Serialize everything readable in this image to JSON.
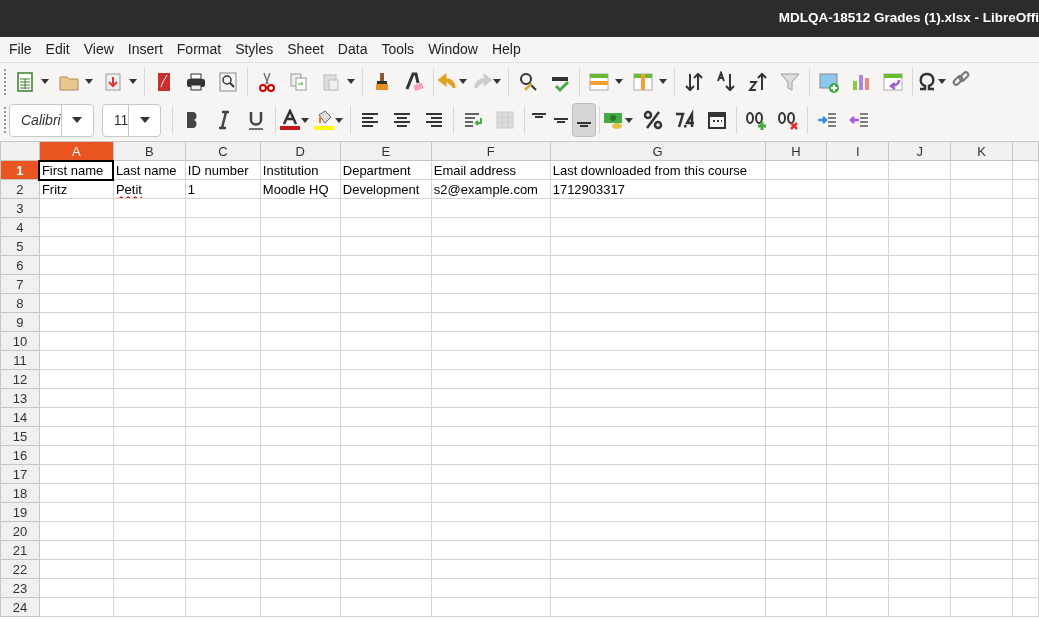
{
  "window": {
    "title": "MDLQA-18512 Grades (1).xlsx - LibreOffi"
  },
  "menu": [
    "File",
    "Edit",
    "View",
    "Insert",
    "Format",
    "Styles",
    "Sheet",
    "Data",
    "Tools",
    "Window",
    "Help"
  ],
  "font_name": {
    "value": "Calibri"
  },
  "font_size": {
    "value": "11"
  },
  "vertical_align": [
    {
      "selected": false
    },
    {
      "selected": false
    },
    {
      "selected": true
    }
  ],
  "sheet": {
    "columns": [
      {
        "label": "A",
        "selected": true
      },
      {
        "label": "B",
        "selected": false
      },
      {
        "label": "C",
        "selected": false
      },
      {
        "label": "D",
        "selected": false
      },
      {
        "label": "E",
        "selected": false
      },
      {
        "label": "F",
        "selected": false
      },
      {
        "label": "G",
        "selected": false
      },
      {
        "label": "H",
        "selected": false
      },
      {
        "label": "I",
        "selected": false
      },
      {
        "label": "J",
        "selected": false
      },
      {
        "label": "K",
        "selected": false
      }
    ],
    "rows": [
      {
        "label": "1",
        "selected": true,
        "cells": [
          {
            "text": "First name",
            "selected": true,
            "misspelled": false
          },
          {
            "text": "Last name",
            "selected": false,
            "misspelled": false
          },
          {
            "text": "ID number",
            "selected": false,
            "misspelled": false
          },
          {
            "text": "Institution",
            "selected": false,
            "misspelled": false
          },
          {
            "text": "Department",
            "selected": false,
            "misspelled": false
          },
          {
            "text": "Email address",
            "selected": false,
            "misspelled": false
          },
          {
            "text": "Last downloaded from this course",
            "selected": false,
            "misspelled": false
          }
        ]
      },
      {
        "label": "2",
        "selected": false,
        "cells": [
          {
            "text": "Fritz",
            "selected": false,
            "misspelled": false
          },
          {
            "text": "Petit",
            "selected": false,
            "misspelled": true
          },
          {
            "text": "1",
            "selected": false,
            "misspelled": false
          },
          {
            "text": "Moodle HQ",
            "selected": false,
            "misspelled": false
          },
          {
            "text": "Development",
            "selected": false,
            "misspelled": false
          },
          {
            "text": "s2@example.com",
            "selected": false,
            "misspelled": false
          },
          {
            "text": "1712903317",
            "selected": false,
            "misspelled": false
          }
        ]
      },
      {
        "label": "3",
        "selected": false
      },
      {
        "label": "4",
        "selected": false
      },
      {
        "label": "5",
        "selected": false
      },
      {
        "label": "6",
        "selected": false
      },
      {
        "label": "7",
        "selected": false
      },
      {
        "label": "8",
        "selected": false
      },
      {
        "label": "9",
        "selected": false
      },
      {
        "label": "10",
        "selected": false
      },
      {
        "label": "11",
        "selected": false
      },
      {
        "label": "12",
        "selected": false
      },
      {
        "label": "13",
        "selected": false
      },
      {
        "label": "14",
        "selected": false
      },
      {
        "label": "15",
        "selected": false
      },
      {
        "label": "16",
        "selected": false
      },
      {
        "label": "17",
        "selected": false
      },
      {
        "label": "18",
        "selected": false
      },
      {
        "label": "19",
        "selected": false
      },
      {
        "label": "20",
        "selected": false
      },
      {
        "label": "21",
        "selected": false
      },
      {
        "label": "22",
        "selected": false
      },
      {
        "label": "23",
        "selected": false
      },
      {
        "label": "24",
        "selected": false
      }
    ]
  }
}
